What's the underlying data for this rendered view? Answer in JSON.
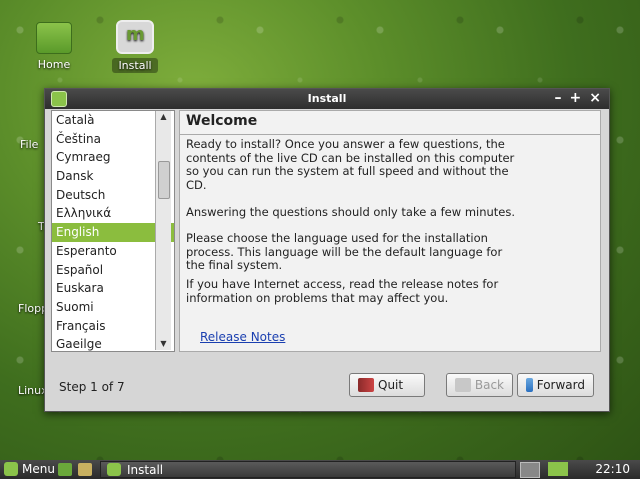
{
  "desktop": {
    "icons": [
      {
        "label": "Home"
      },
      {
        "label": "Install"
      }
    ],
    "partial_labels": [
      "File",
      "T",
      "Flopp",
      "Linux"
    ]
  },
  "window": {
    "title": "Install",
    "controls": [
      "–",
      "+",
      "×"
    ],
    "languages": [
      "Català",
      "Čeština",
      "Cymraeg",
      "Dansk",
      "Deutsch",
      "Ελληνικά",
      "English",
      "Esperanto",
      "Español",
      "Euskara",
      "Suomi",
      "Français",
      "Gaeilge"
    ],
    "selected_language": "English",
    "heading": "Welcome",
    "paragraphs": [
      "Ready to install? Once you answer a few questions, the contents of the live CD can be installed on this computer so you can run the system at full speed and without the CD.",
      "Answering the questions should only take a few minutes.",
      "Please choose the language used for the installation process. This language will be the default language for the final system.",
      "If you have Internet access, read the release notes for information on problems that may affect you."
    ],
    "release_notes_link": "Release Notes",
    "step": "Step 1 of 7",
    "buttons": {
      "quit": "Quit",
      "back": "Back",
      "forward": "Forward"
    }
  },
  "taskbar": {
    "menu_label": "Menu",
    "task_label": "Install",
    "clock": "22:10"
  },
  "colors": {
    "accent": "#8bbd3e",
    "link": "#1a3fb0"
  }
}
